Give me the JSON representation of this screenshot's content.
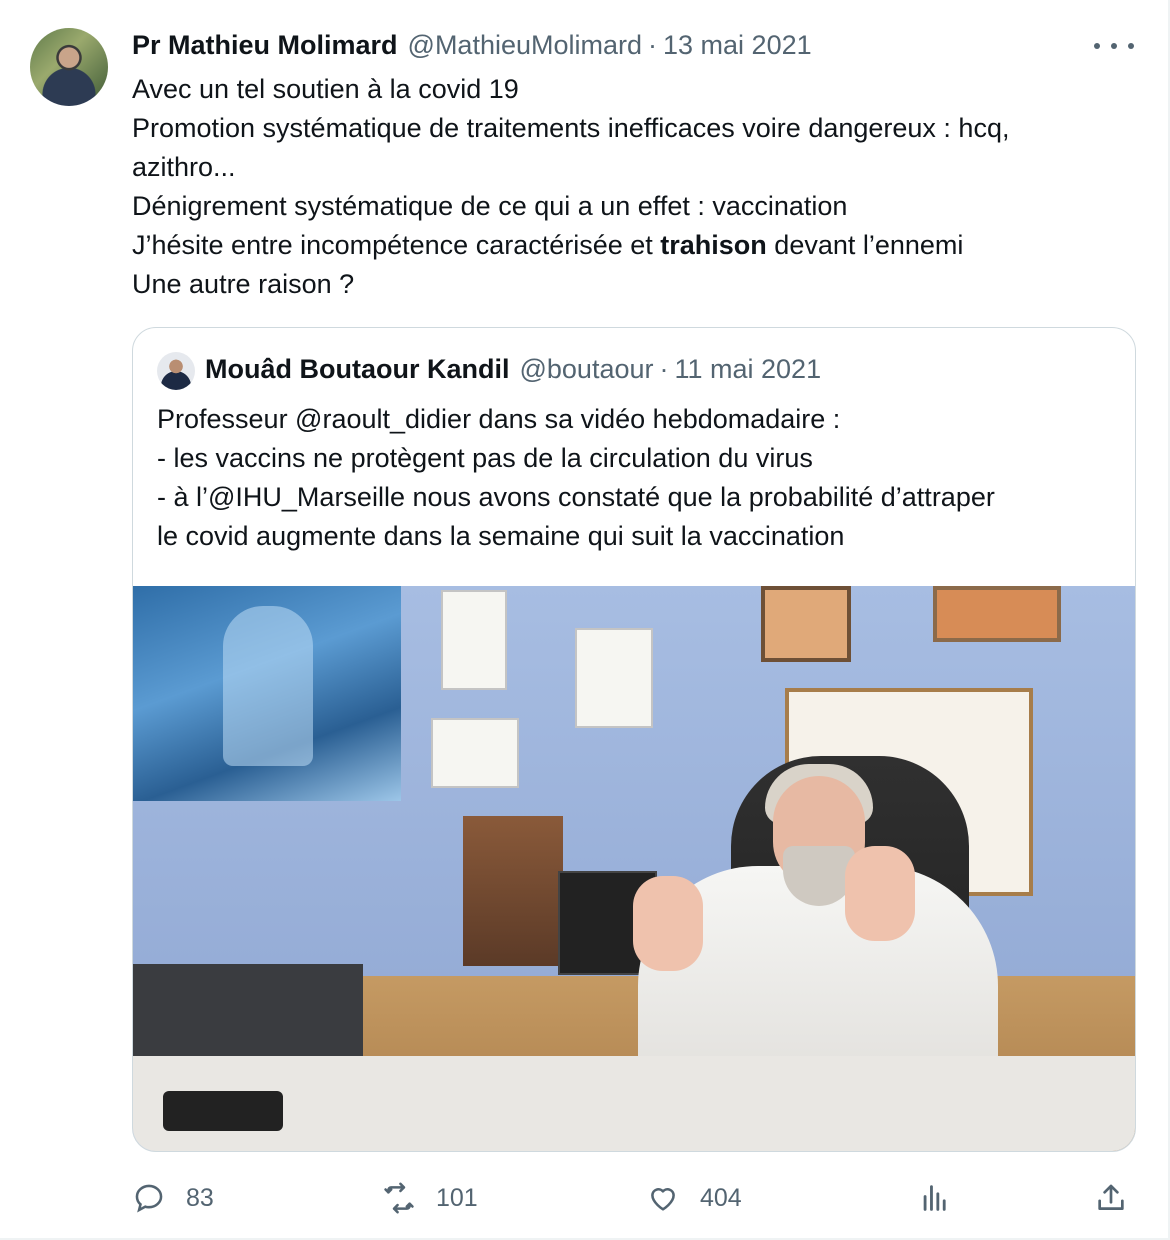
{
  "tweet": {
    "author_name": "Pr Mathieu Molimard",
    "author_handle": "@MathieuMolimard",
    "separator": "·",
    "date": "13 mai 2021",
    "lines": [
      "Avec un tel soutien à la covid 19",
      "Promotion systématique de traitements inefficaces voire dangereux  : hcq,",
      "azithro...",
      "Dénigrement systématique de ce qui a un effet : vaccination"
    ],
    "line5_before": "J’hésite entre incompétence caractérisée et ",
    "line5_bold": "trahison",
    "line5_after": " devant l’ennemi",
    "line6": "Une autre raison ?"
  },
  "quote": {
    "author_name": "Mouâd Boutaour Kandil",
    "author_handle": "@boutaour",
    "separator": "·",
    "date": "11 mai 2021",
    "lines": [
      "Professeur @raoult_didier dans sa vidéo hebdomadaire :",
      "- les vaccins ne protègent pas de la circulation du virus",
      "- à l’@IHU_Marseille nous avons constaté que la probabilité d’attraper",
      "le covid augmente dans la semaine qui suit la vaccination"
    ]
  },
  "actions": {
    "replies": "83",
    "retweets": "101",
    "likes": "404"
  },
  "icons": {
    "more": "more-dots-icon",
    "reply": "reply-icon",
    "retweet": "retweet-icon",
    "like": "heart-icon",
    "views": "analytics-icon",
    "share": "share-icon"
  },
  "colors": {
    "text": "#0f1419",
    "secondary": "#536471",
    "border": "#cfd9de"
  }
}
